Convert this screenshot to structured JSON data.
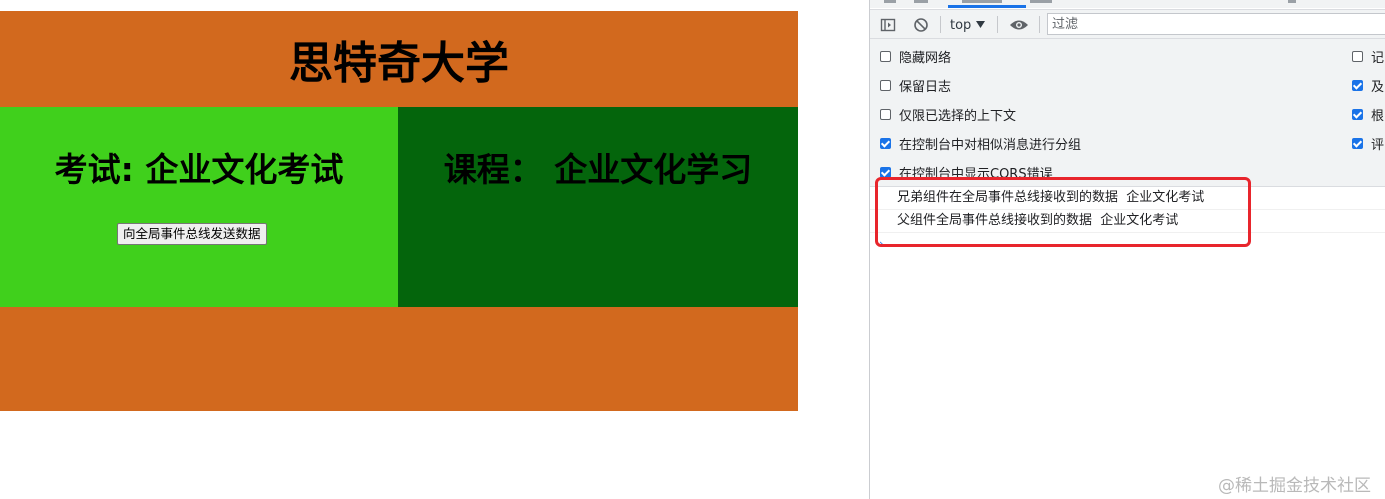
{
  "page": {
    "title": "思特奇大学",
    "exam_panel": {
      "heading": "考试: 企业文化考试",
      "button_label": "向全局事件总线发送数据"
    },
    "course_panel": {
      "heading": "课程： 企业文化学习"
    },
    "colors": {
      "parent_bg": "#d2691e",
      "exam_bg": "#40d01c",
      "course_bg": "#04650c"
    }
  },
  "devtools": {
    "toolbar": {
      "context": "top",
      "filter_placeholder": "过滤",
      "icons": [
        "sidebar-toggle-icon",
        "clear-console-icon",
        "eye-icon",
        "dropdown-triangle-icon"
      ]
    },
    "settings_left": [
      {
        "label": "隐藏网络",
        "checked": false
      },
      {
        "label": "保留日志",
        "checked": false
      },
      {
        "label": "仅限已选择的上下文",
        "checked": false
      },
      {
        "label": "在控制台中对相似消息进行分组",
        "checked": true
      },
      {
        "label": "在控制台中显示CORS错误",
        "checked": true
      }
    ],
    "settings_right": [
      {
        "label": "记",
        "checked": false
      },
      {
        "label": "及",
        "checked": true
      },
      {
        "label": "根",
        "checked": true
      },
      {
        "label": "评",
        "checked": true
      }
    ],
    "console_messages": [
      "兄弟组件在全局事件总线接收到的数据  企业文化考试",
      "父组件全局事件总线接收到的数据  企业文化考试"
    ],
    "prompt_symbol": "›"
  },
  "watermark": "@稀土掘金技术社区",
  "accent_colors": {
    "highlight": "#e8252c",
    "devtools_blue": "#1a73e8"
  }
}
